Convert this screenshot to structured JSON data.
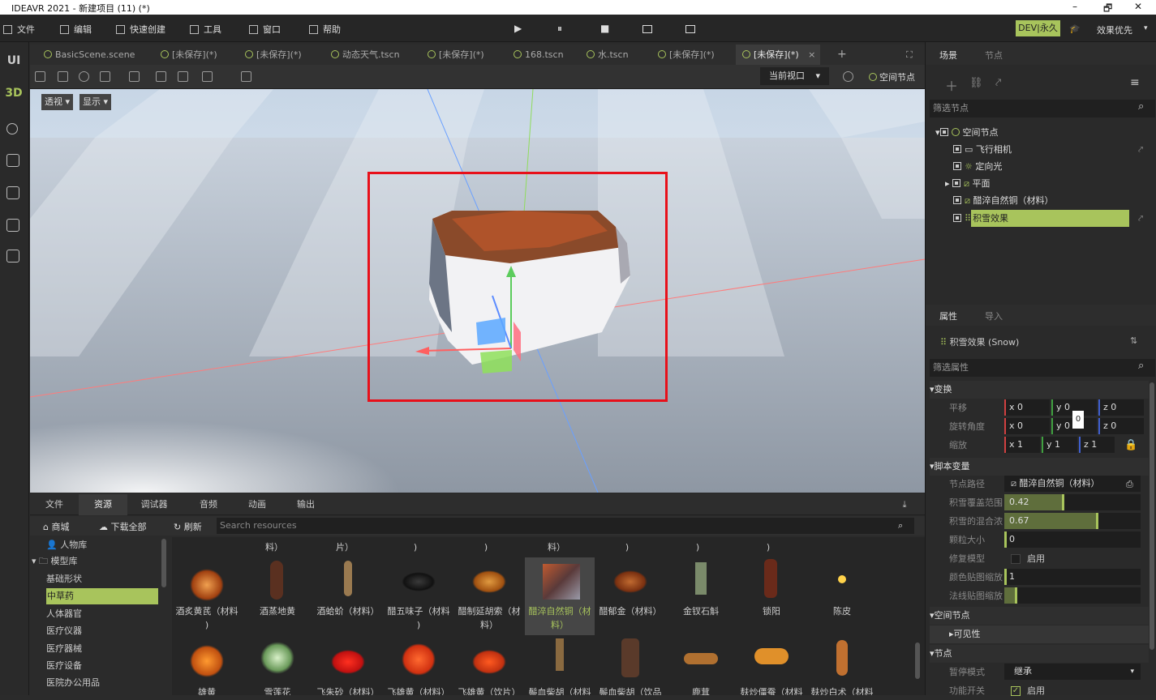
{
  "window": {
    "title": "IDEAVR 2021 - 新建项目 (11) (*)",
    "minimize": "–",
    "restore": "🗗",
    "close": "✕"
  },
  "menu": {
    "file": "文件",
    "edit": "编辑",
    "quick_create": "快速创建",
    "tools": "工具",
    "window": "窗口",
    "help": "帮助"
  },
  "playback": {
    "play": "▶",
    "pause": "⏸",
    "stop": "■"
  },
  "right_menu": {
    "badge": "DEV|永久",
    "quality": "效果优先"
  },
  "left_bar": {
    "ui": "UI",
    "threed": "3D"
  },
  "tabs": [
    "BasicScene.scene",
    "[未保存](*)",
    "[未保存](*)",
    "动态天气.tscn",
    "[未保存](*)",
    "168.tscn",
    "水.tscn",
    "[未保存](*)",
    "[未保存](*)"
  ],
  "tab_close": "×",
  "tab_add": "+",
  "viewport_toolbar": {
    "current_view": "当前视口",
    "spatial_node": "空间节点"
  },
  "viewport": {
    "perspective": "透视",
    "display": "显示",
    "tooltip": "0"
  },
  "bottom_tabs": [
    "文件",
    "资源",
    "调试器",
    "音频",
    "动画",
    "输出"
  ],
  "bottom_toolbar": {
    "store": "商城",
    "download_all": "下载全部",
    "refresh": "刷新",
    "search_placeholder": "Search resources"
  },
  "categories": [
    "人物库",
    "模型库",
    "基础形状",
    "中草药",
    "人体器官",
    "医疗仪器",
    "医疗器械",
    "医疗设备",
    "医院办公用品"
  ],
  "assets_row0": [
    "料）",
    "片）",
    ")",
    ")",
    "料）",
    ")",
    ")",
    ")"
  ],
  "assets_row1": [
    {
      "label": "酒炙黄芪（材料",
      "label2": ")"
    },
    {
      "label": "酒蒸地黄",
      "label2": ""
    },
    {
      "label": "酒蛤蚧（材料）",
      "label2": ""
    },
    {
      "label": "醋五味子（材料",
      "label2": ")"
    },
    {
      "label": "醋制延胡索（材",
      "label2": "料）"
    },
    {
      "label": "醋淬自然铜（材",
      "label2": "料）"
    },
    {
      "label": "醋郁金（材料）",
      "label2": ""
    },
    {
      "label": "金钗石斛",
      "label2": ""
    },
    {
      "label": "锁阳",
      "label2": ""
    },
    {
      "label": "陈皮",
      "label2": ""
    }
  ],
  "assets_row2": [
    "雄黄",
    "雪莲花",
    "飞朱砂（材料）",
    "飞雄黄（材料）",
    "飞雄黄（饮片）",
    "鬃血柴胡（材料",
    "鬃血柴胡（饮品",
    "鹿茸",
    "麸炒僵蚕（材料",
    "麸炒白术（材料"
  ],
  "right_panel": {
    "scene_tab": "场景",
    "node_tab": "节点",
    "filter_nodes": "筛选节点",
    "tree": [
      "空间节点",
      "飞行相机",
      "定向光",
      "平面",
      "醋淬自然铜（材料）",
      "积雪效果"
    ],
    "props_tab": "属性",
    "import_tab": "导入",
    "selected": "积雪效果 (Snow)",
    "filter_props": "筛选属性",
    "transform": "变换",
    "translate": "平移",
    "rotate": "旋转角度",
    "scale": "缩放",
    "t": {
      "x": "0",
      "y": "0",
      "z": "0"
    },
    "r": {
      "x": "0",
      "y": "0",
      "z": "0"
    },
    "s": {
      "x": "1",
      "y": "1",
      "z": "1"
    },
    "script_vars": "脚本变量",
    "node_path": "节点路径",
    "node_path_val": "醋淬自然铜（材料）",
    "coverage": "积雪覆盖范围",
    "coverage_val": "0.42",
    "blend": "积雪的混合浓",
    "blend_val": "0.67",
    "particle": "颗粒大小",
    "particle_val": "0",
    "repair": "修复模型",
    "enable": "启用",
    "color_scale": "颜色贴图缩放",
    "color_scale_val": "1",
    "normal_scale": "法线贴图缩放",
    "spatial_section": "空间节点",
    "visibility": "可见性",
    "node_section": "节点",
    "pause_mode": "暂停模式",
    "pause_val": "继承",
    "toggle": "功能开关",
    "toggle_val": "启用"
  },
  "colors": {
    "accent": "#a8c45c",
    "selection": "#e8101a"
  }
}
